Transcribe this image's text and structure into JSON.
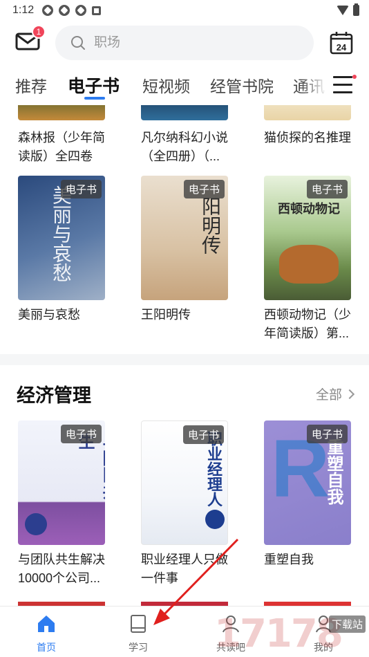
{
  "status_bar": {
    "time": "1:12"
  },
  "header": {
    "message_badge": "1",
    "search_placeholder": "职场"
  },
  "calendar": {
    "day": "24"
  },
  "tabs": [
    {
      "label": "推荐"
    },
    {
      "label": "电子书",
      "active": true
    },
    {
      "label": "短视频"
    },
    {
      "label": "经管书院"
    },
    {
      "label": "通讯"
    }
  ],
  "top_books_partial": [
    {
      "title": "森林报（少年简读版）全四卷"
    },
    {
      "title": "凡尔纳科幻小说（全四册）（..."
    },
    {
      "title": "猫侦探的名推理"
    }
  ],
  "books_row": [
    {
      "title": "美丽与哀愁",
      "tag": "电子书",
      "cover_text": "美丽与哀愁"
    },
    {
      "title": "王阳明传",
      "tag": "电子书",
      "cover_text": "阳明传"
    },
    {
      "title": "西顿动物记（少年简读版）第...",
      "tag": "电子书",
      "cover_text": "西顿动物记"
    }
  ],
  "section": {
    "title": "经济管理",
    "more_label": "全部"
  },
  "econ_books": [
    {
      "title": "与团队共生解决10000个公司...",
      "tag": "电子书",
      "cover_text": "与团队共生"
    },
    {
      "title": "职业经理人只做一件事",
      "tag": "电子书",
      "cover_text": "职业经理人"
    },
    {
      "title": "重塑自我",
      "tag": "电子书",
      "cover_text": "重塑自我"
    }
  ],
  "bottom_nav": [
    {
      "label": "首页",
      "active": true
    },
    {
      "label": "学习"
    },
    {
      "label": "共读吧"
    },
    {
      "label": "我的"
    }
  ],
  "watermark": {
    "text": "17178",
    "badge": "下载站"
  },
  "colors": {
    "accent": "#2d7cf0",
    "badge": "#f0455a"
  }
}
